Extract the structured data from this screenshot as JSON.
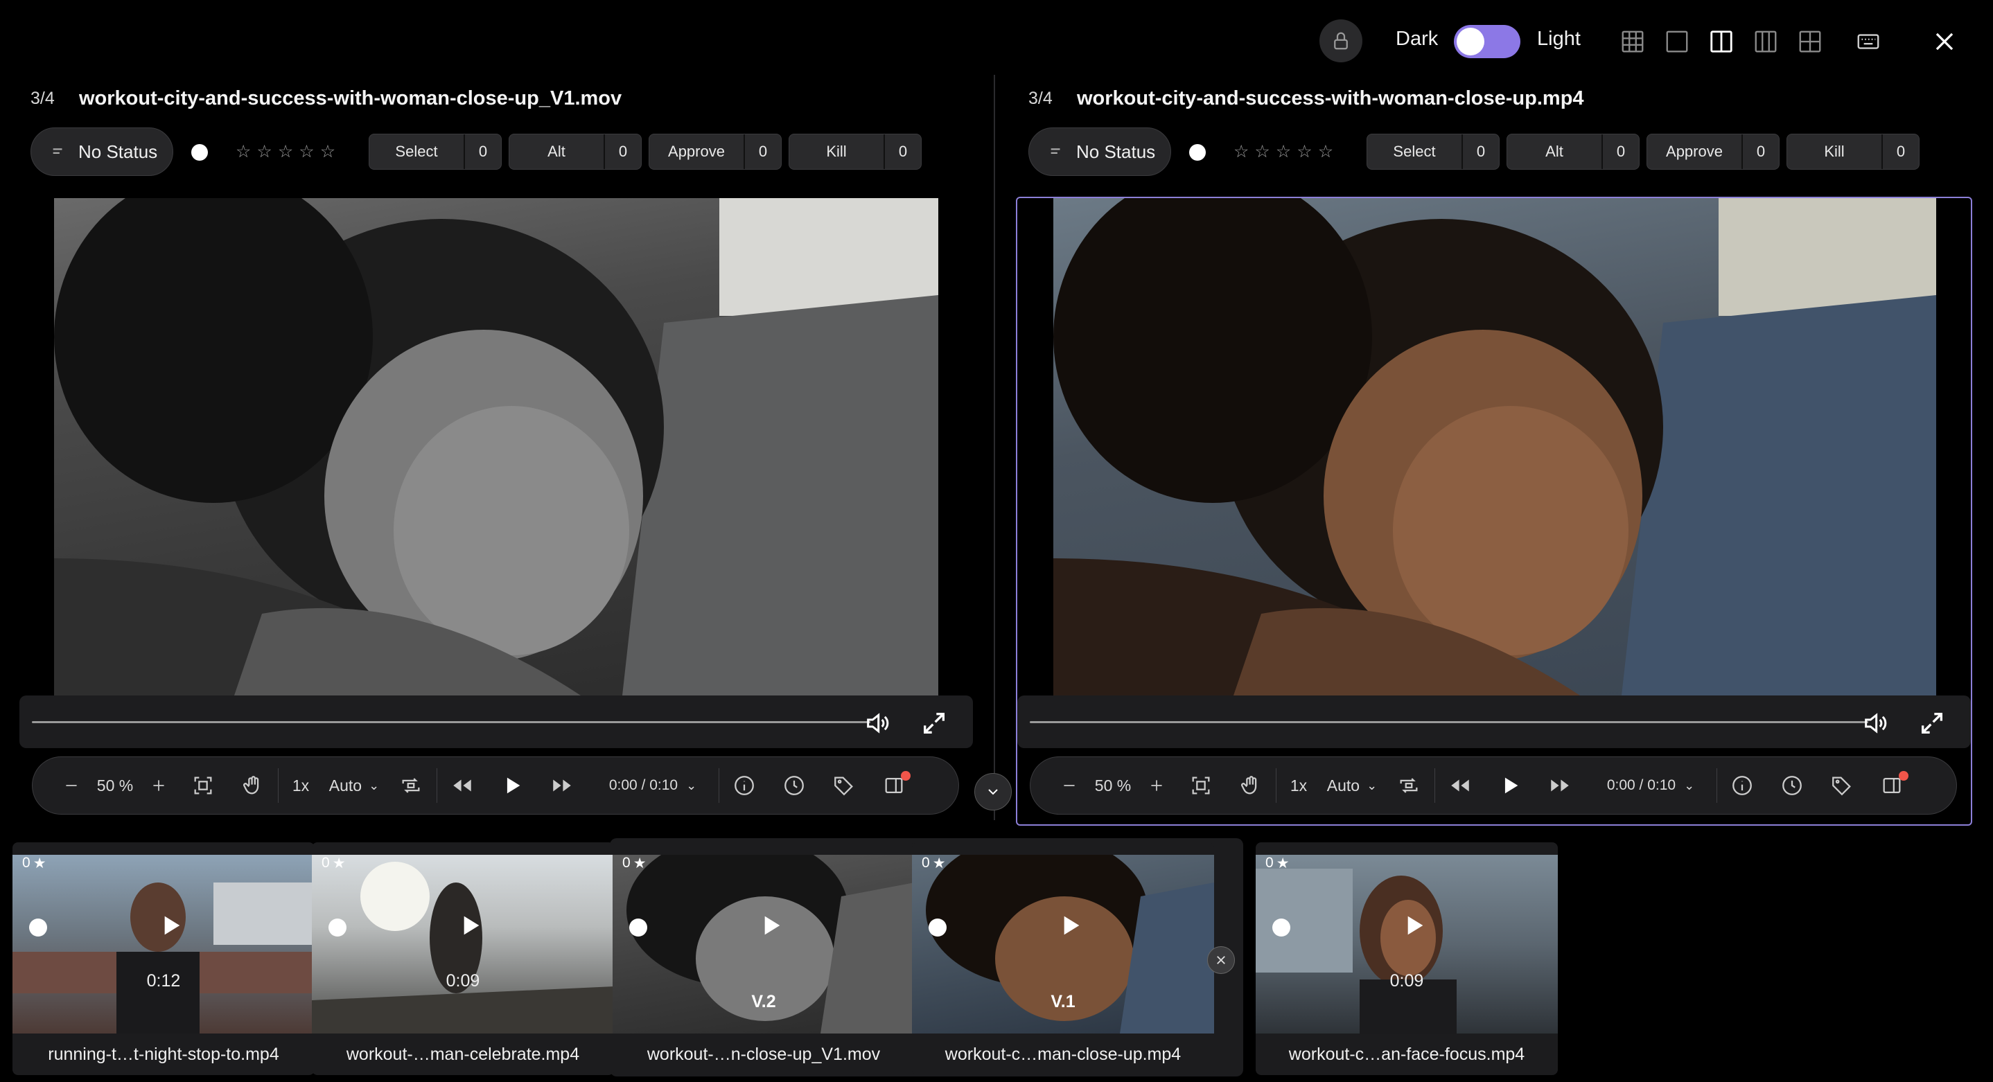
{
  "theme": {
    "dark_label": "Dark",
    "light_label": "Light",
    "accent": "#8c78e6"
  },
  "panels": [
    {
      "counter": "3/4",
      "title": "workout-city-and-success-with-woman-close-up_V1.mov",
      "status": "No Status",
      "votes": [
        {
          "label": "Select",
          "count": "0"
        },
        {
          "label": "Alt",
          "count": "0"
        },
        {
          "label": "Approve",
          "count": "0"
        },
        {
          "label": "Kill",
          "count": "0"
        }
      ],
      "zoom": "50 %",
      "speed": "1x",
      "quality": "Auto",
      "time": "0:00 / 0:10"
    },
    {
      "counter": "3/4",
      "title": "workout-city-and-success-with-woman-close-up.mp4",
      "status": "No Status",
      "votes": [
        {
          "label": "Select",
          "count": "0"
        },
        {
          "label": "Alt",
          "count": "0"
        },
        {
          "label": "Approve",
          "count": "0"
        },
        {
          "label": "Kill",
          "count": "0"
        }
      ],
      "zoom": "50 %",
      "speed": "1x",
      "quality": "Auto",
      "time": "0:00 / 0:10"
    }
  ],
  "filmstrip": [
    {
      "stars": "0",
      "duration": "0:12",
      "version": "",
      "name": "running-t…t-night-stop-to.mp4"
    },
    {
      "stars": "0",
      "duration": "0:09",
      "version": "",
      "name": "workout-…man-celebrate.mp4"
    },
    {
      "stars": "0",
      "duration": "",
      "version": "V.2",
      "name": "workout-…n-close-up_V1.mov"
    },
    {
      "stars": "0",
      "duration": "",
      "version": "V.1",
      "name": "workout-c…man-close-up.mp4"
    },
    {
      "stars": "0",
      "duration": "0:09",
      "version": "",
      "name": "workout-c…an-face-focus.mp4"
    }
  ]
}
